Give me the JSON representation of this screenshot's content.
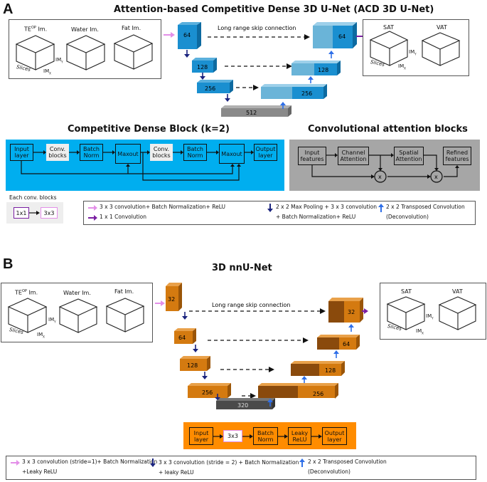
{
  "panel_a": {
    "letter": "A",
    "title": "Attention-based Competitive Dense 3D U-Net (ACD 3D U-Net)",
    "inputs": [
      {
        "label": "TE",
        "sup": "OP",
        "suffix": " Im."
      },
      {
        "label": "Water Im."
      },
      {
        "label": "Fat Im."
      }
    ],
    "axis_labels": {
      "y": "IM",
      "y_sub": "Y",
      "x": "IM",
      "x_sub": "X",
      "slices": "Slices"
    },
    "outputs": [
      {
        "label": "SAT"
      },
      {
        "label": "VAT"
      }
    ],
    "skip_label": "Long range skip connection",
    "encoder": [
      "64",
      "128",
      "256"
    ],
    "bottleneck": "512",
    "decoder": [
      "256",
      "128",
      "64"
    ],
    "colors": {
      "block": "#1a8fd0",
      "block_light": "#6ab4d8",
      "bottleneck": "#8a8a8a"
    },
    "cdb": {
      "title": "Competitive Dense Block (k=2)",
      "bg": "#00aeef",
      "blocks": [
        "Input layer",
        "Conv. blocks",
        "Batch Norm",
        "Maxout",
        "Conv. blocks",
        "Batch Norm",
        "Maxout",
        "Output layer"
      ]
    },
    "cab": {
      "title": "Convolutional attention blocks",
      "bg": "#a6a6a6",
      "blocks": [
        "Input features",
        "Channel Attention",
        "Spatial Attention",
        "Refined features"
      ],
      "multiply": "x"
    },
    "conv_blocks": {
      "title": "Each conv. blocks",
      "items": [
        "1x1",
        "3x3"
      ]
    },
    "legend": [
      {
        "icon": "pink-arrow-right-icon",
        "color": "#e38fe8",
        "text": "3 x 3 convolution+ Batch Normalization+ ReLU"
      },
      {
        "icon": "purple-arrow-right-icon",
        "color": "#7a1fa2",
        "text": "1 x 1 Convolution"
      },
      {
        "icon": "navy-arrow-down-icon",
        "color": "#1a237e",
        "text": "2 x 2 Max Pooling + 3 x 3 convolution",
        "text2": "+ Batch Normalization+ ReLU"
      },
      {
        "icon": "blue-arrow-up-icon",
        "color": "#2f6fe8",
        "text": "2 x 2 Transposed Convolution",
        "text2": "(Deconvolution)"
      }
    ]
  },
  "panel_b": {
    "letter": "B",
    "title": "3D nnU-Net",
    "inputs": [
      {
        "label": "TE",
        "sup": "OP",
        "suffix": " Im."
      },
      {
        "label": "Water Im."
      },
      {
        "label": "Fat Im."
      }
    ],
    "axis_labels": {
      "y": "IM",
      "y_sub": "Y",
      "x": "IM",
      "x_sub": "X",
      "slices": "Slices"
    },
    "outputs": [
      {
        "label": "SAT"
      },
      {
        "label": "VAT"
      }
    ],
    "skip_label": "Long range skip connection",
    "encoder": [
      "32",
      "64",
      "128",
      "256"
    ],
    "bottleneck": "320",
    "decoder": [
      "256",
      "128",
      "64",
      "32"
    ],
    "colors": {
      "block": "#d47a10",
      "block_dark": "#8a4a0c",
      "bottleneck": "#4a4a4a"
    },
    "block_flow": {
      "bg": "#ff8c00",
      "blocks": [
        "Input layer",
        "3x3",
        "Batch Norm",
        "Leaky ReLU",
        "Output layer"
      ]
    },
    "legend": [
      {
        "icon": "pink-arrow-right-icon",
        "color": "#e38fe8",
        "text": "3 x 3 convolution (stride=1)+ Batch Normalization",
        "text2": "+Leaky ReLU"
      },
      {
        "icon": "navy-arrow-down-icon",
        "color": "#1a237e",
        "text": "3 x 3 convolution (stride = 2) + Batch Normalization",
        "text2": "+ leaky ReLU"
      },
      {
        "icon": "blue-arrow-up-icon",
        "color": "#2f6fe8",
        "text": "2 x 2 Transposed Convolution",
        "text2": "(Deconvolution)"
      }
    ]
  }
}
